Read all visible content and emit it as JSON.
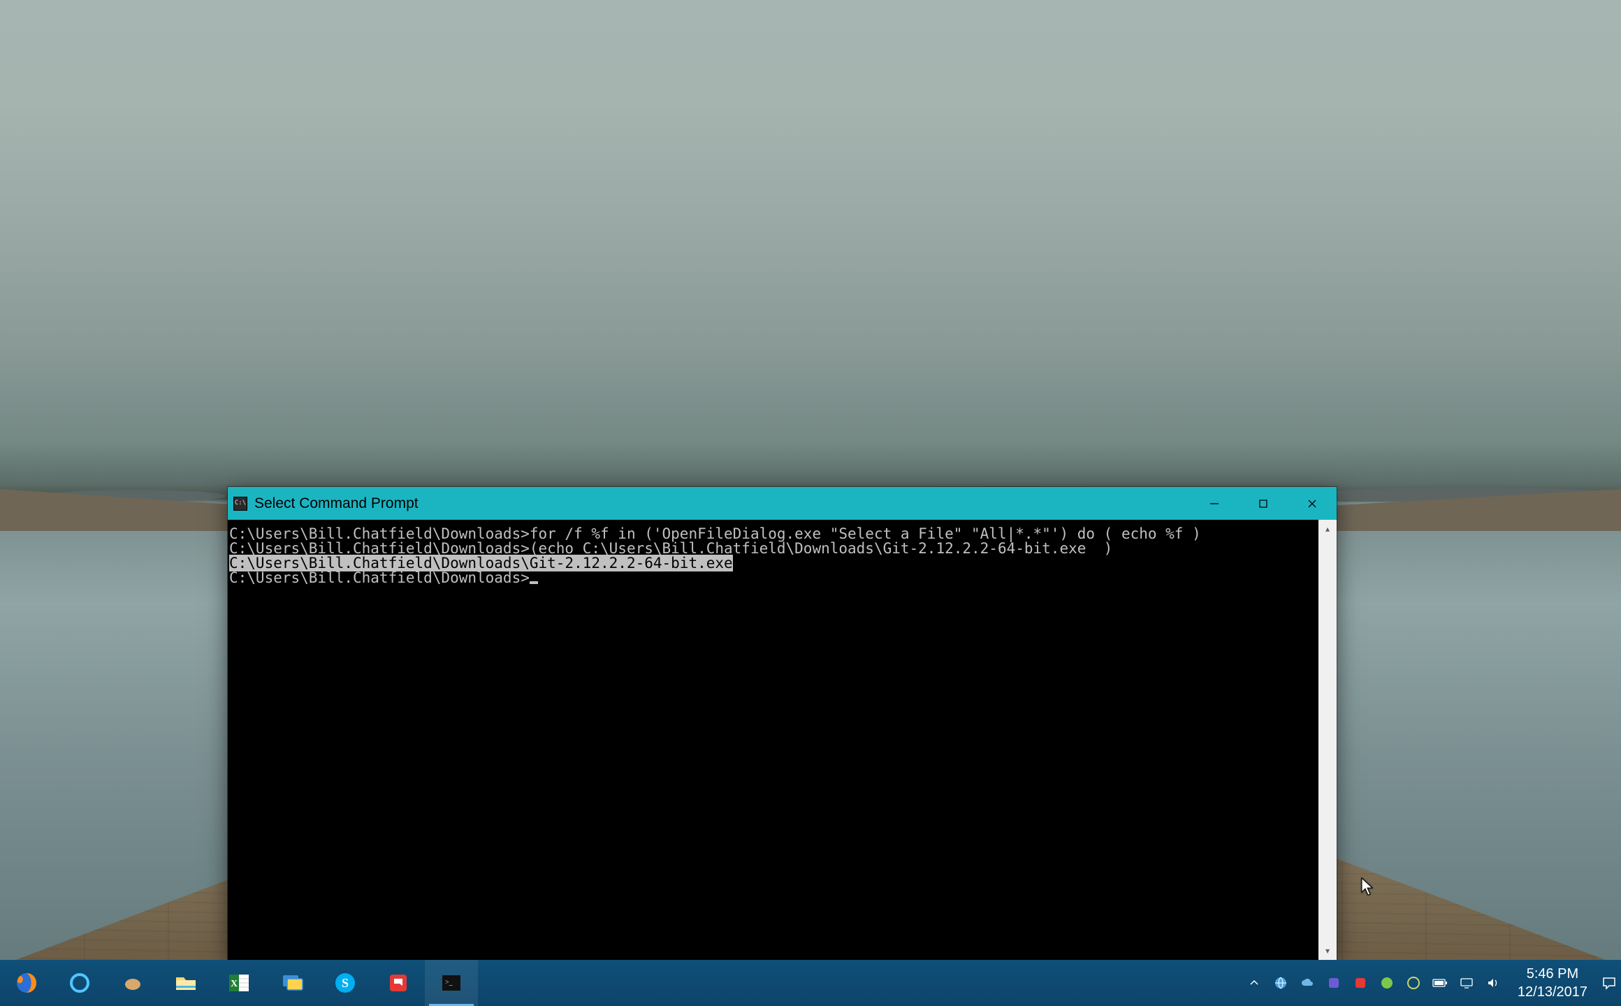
{
  "window": {
    "title": "Select Command Prompt"
  },
  "terminal": {
    "line1": "C:\\Users\\Bill.Chatfield\\Downloads>for /f %f in ('OpenFileDialog.exe \"Select a File\" \"All|*.*\"') do ( echo %f )",
    "blank1": "",
    "line2": "C:\\Users\\Bill.Chatfield\\Downloads>(echo C:\\Users\\Bill.Chatfield\\Downloads\\Git-2.12.2.2-64-bit.exe  )",
    "line3_selected": "C:\\Users\\Bill.Chatfield\\Downloads\\Git-2.12.2.2-64-bit.exe",
    "blank2": "",
    "prompt": "C:\\Users\\Bill.Chatfield\\Downloads>"
  },
  "taskbar": {
    "apps": [
      {
        "name": "firefox"
      },
      {
        "name": "cortana"
      },
      {
        "name": "app-icon"
      },
      {
        "name": "file-explorer"
      },
      {
        "name": "excel"
      },
      {
        "name": "remote-desktop"
      },
      {
        "name": "skype"
      },
      {
        "name": "notifications-app"
      },
      {
        "name": "command-prompt"
      }
    ],
    "clock_time": "5:46 PM",
    "clock_date": "12/13/2017"
  }
}
